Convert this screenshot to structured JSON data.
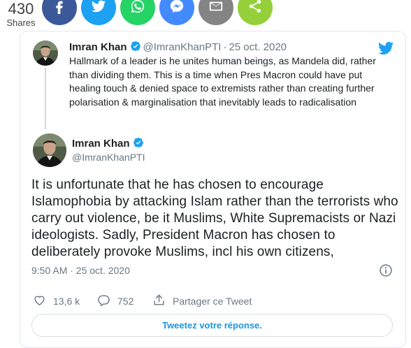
{
  "share": {
    "count": "430",
    "label": "Shares",
    "buttons": [
      {
        "name": "facebook",
        "icon": "facebook-icon",
        "color": "#3b5998"
      },
      {
        "name": "twitter",
        "icon": "twitter-icon",
        "color": "#1da1f2"
      },
      {
        "name": "whatsapp",
        "icon": "whatsapp-icon",
        "color": "#25d366"
      },
      {
        "name": "messenger",
        "icon": "messenger-icon",
        "color": "#448aff"
      },
      {
        "name": "email",
        "icon": "email-icon",
        "color": "#848484"
      },
      {
        "name": "sharethis",
        "icon": "share-icon",
        "color": "#95d03a"
      }
    ]
  },
  "quoted": {
    "name": "Imran Khan",
    "handle": "@ImranKhanPTI",
    "separator": "·",
    "date": "25 oct. 2020",
    "text": "Hallmark of a leader is he unites human beings, as Mandela did, rather than dividing them. This is a time when Pres Macron could have put healing touch & denied space to extremists rather than creating further polarisation & marginalisation that inevitably leads to radicalisation"
  },
  "main": {
    "name": "Imran Khan",
    "handle": "@ImranKhanPTI",
    "text": "It is unfortunate that he has chosen to encourage Islamophobia by attacking Islam rather than the terrorists who carry out violence, be it Muslims, White Supremacists or Nazi ideologists. Sadly, President Macron has chosen to deliberately provoke Muslims, incl his own citizens,",
    "timestamp": "9:50 AM · 25 oct. 2020"
  },
  "actions": {
    "likes": "13,6 k",
    "replies": "752",
    "share_label": "Partager ce Tweet"
  },
  "reply_button": "Tweetez votre réponse.",
  "colors": {
    "twitter_blue": "#1da1f2",
    "link_blue": "#1b95e0",
    "text": "#1c2022",
    "muted": "#697882",
    "border": "#e1e8ed"
  }
}
